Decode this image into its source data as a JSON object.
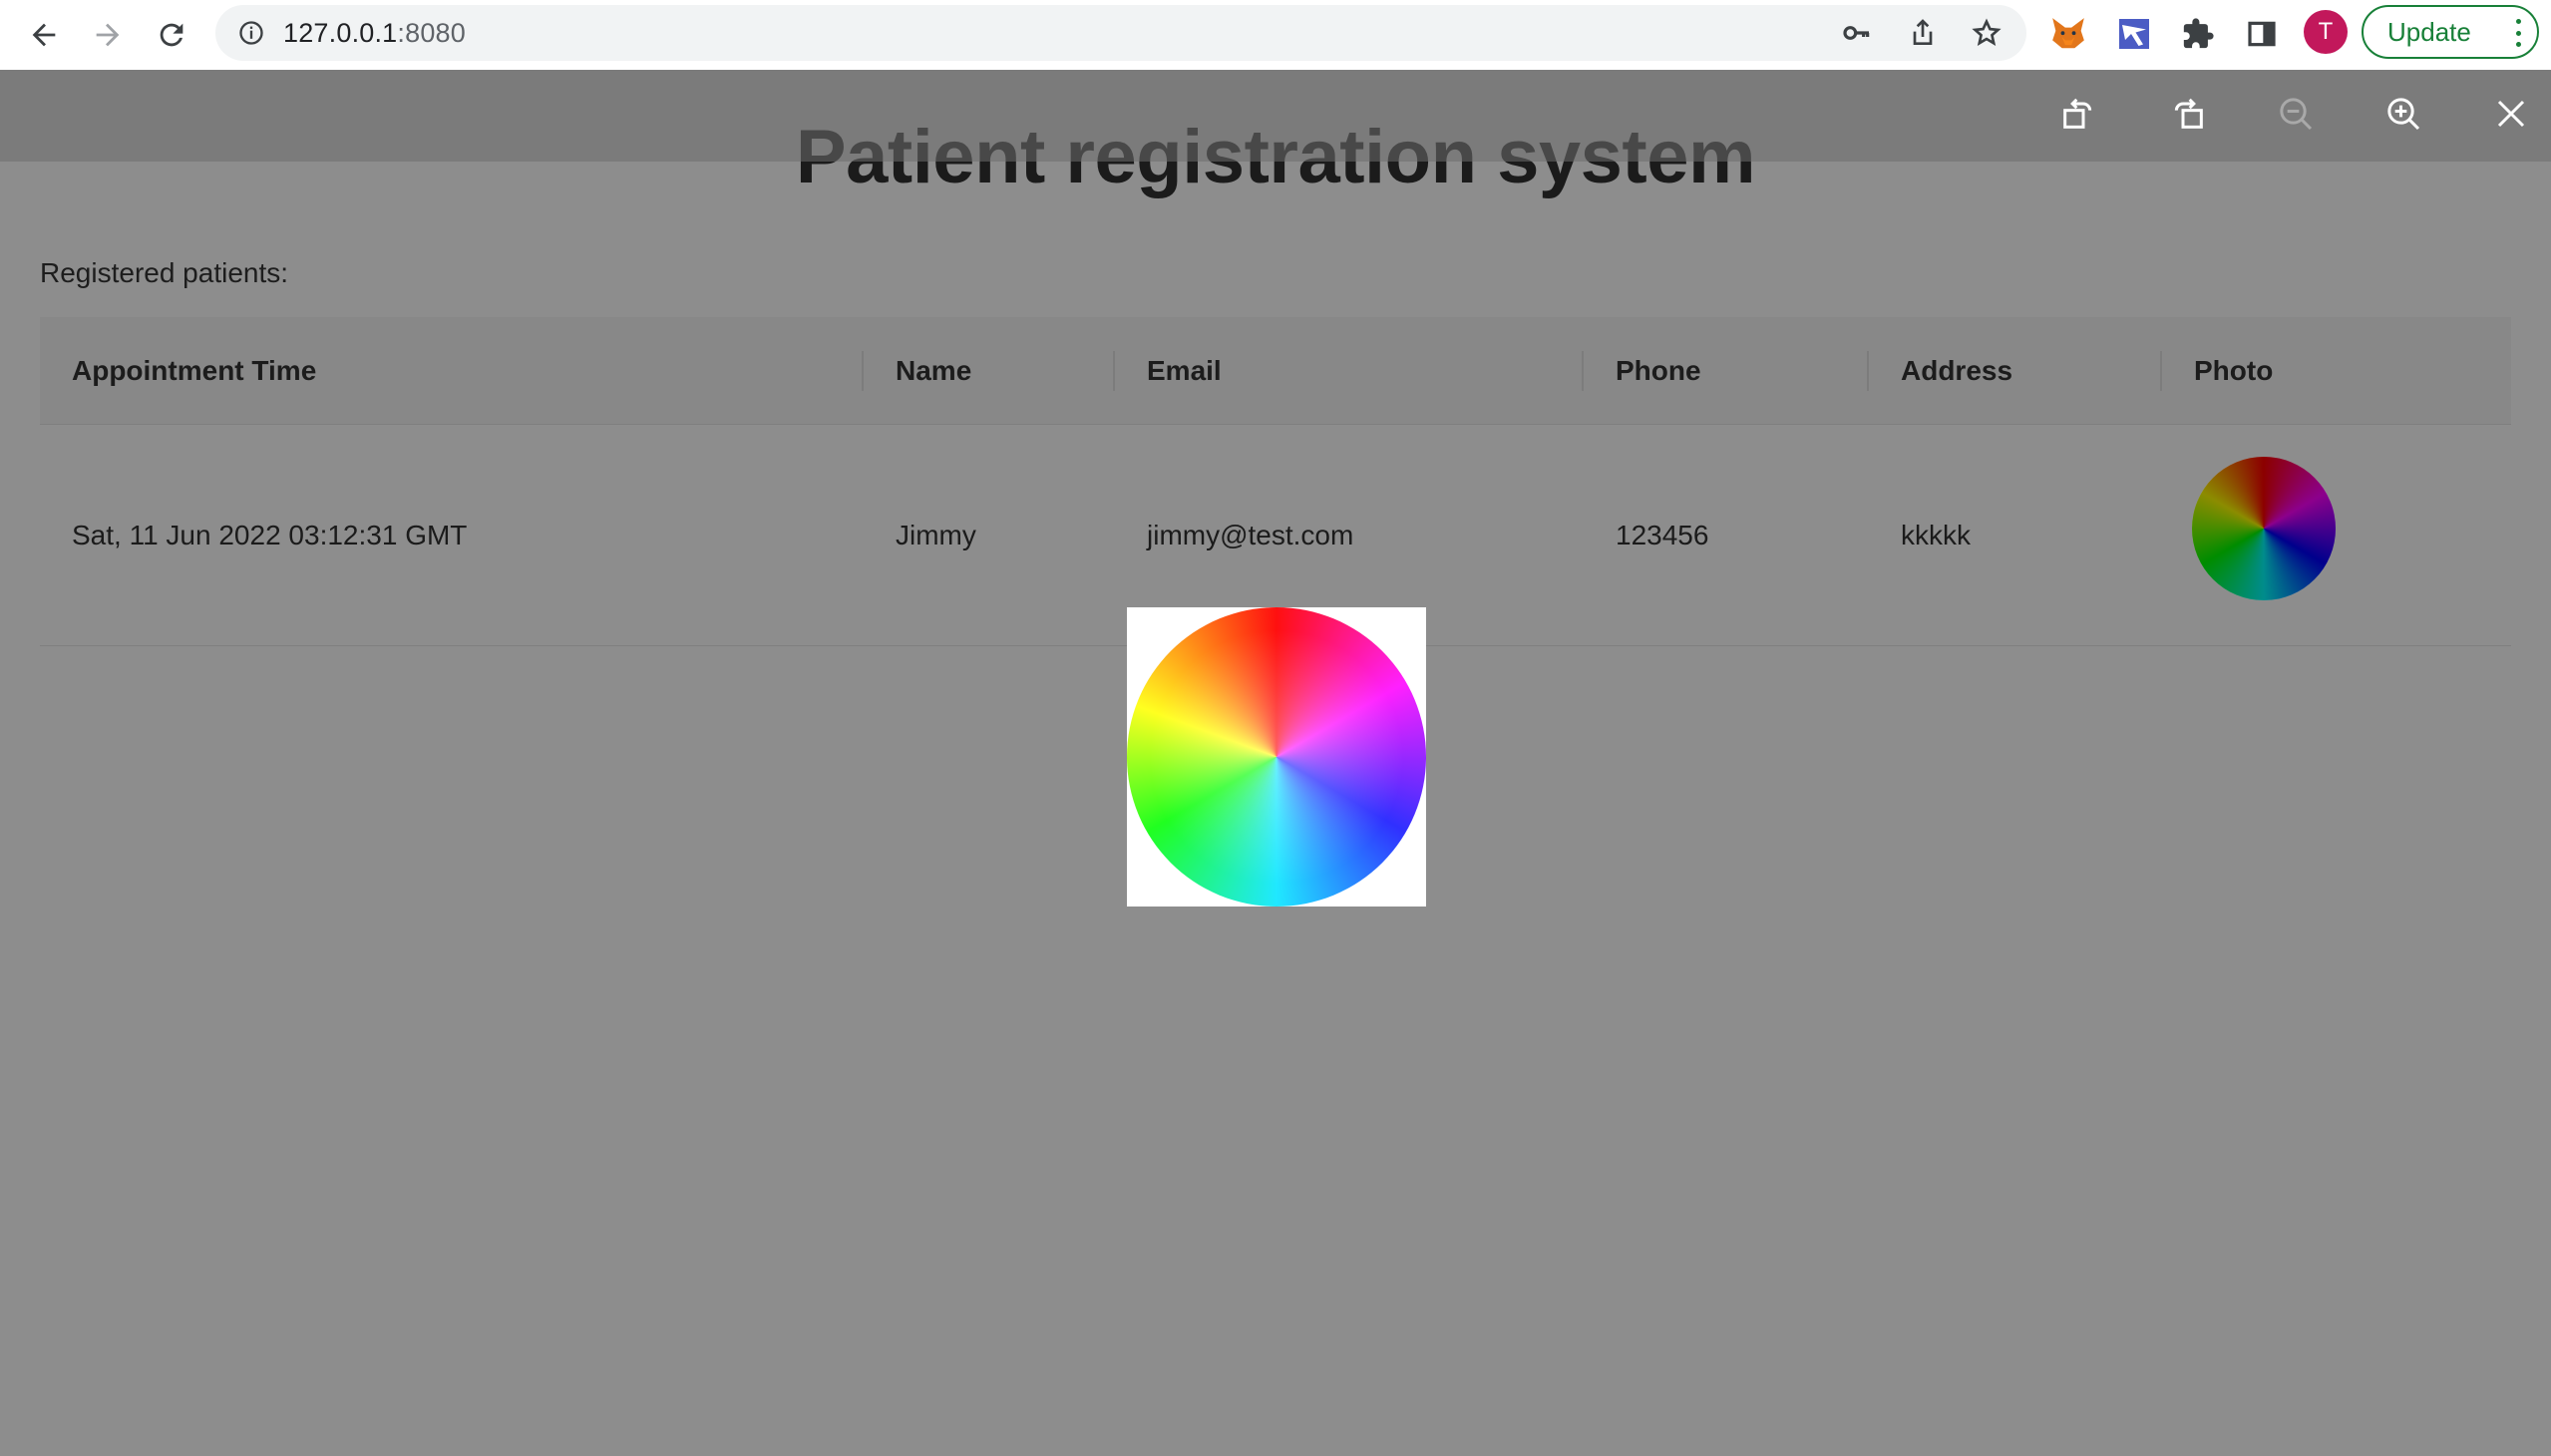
{
  "browser": {
    "url_host": "127.0.0.1",
    "url_port": ":8080",
    "profile_initial": "T",
    "update_label": "Update"
  },
  "icons": {
    "back": "back-arrow-icon",
    "forward": "forward-arrow-icon",
    "reload": "reload-icon",
    "site_info": "info-icon",
    "password_key": "key-icon",
    "share": "share-icon",
    "bookmark": "star-icon",
    "extension_fox": "metamask-fox-icon",
    "extension_vpn": "extension-icon",
    "extensions": "puzzle-icon",
    "side_panel": "side-panel-icon",
    "viewer_rotate_left": "rotate-left-icon",
    "viewer_rotate_right": "rotate-right-icon",
    "viewer_zoom_out": "zoom-out-icon",
    "viewer_zoom_in": "zoom-in-icon",
    "viewer_close": "close-icon"
  },
  "page": {
    "title": "Patient registration system",
    "subtitle": "Registered patients:"
  },
  "table": {
    "headers": [
      "Appointment Time",
      "Name",
      "Email",
      "Phone",
      "Address",
      "Photo"
    ],
    "rows": [
      {
        "appointment_time": "Sat, 11 Jun 2022 03:12:31 GMT",
        "name": "Jimmy",
        "email": "jimmy@test.com",
        "phone": "123456",
        "address": "kkkkk"
      }
    ]
  },
  "colors": {
    "update_green": "#188038",
    "avatar": "#c2185b",
    "mask": "#8d8d8d"
  }
}
